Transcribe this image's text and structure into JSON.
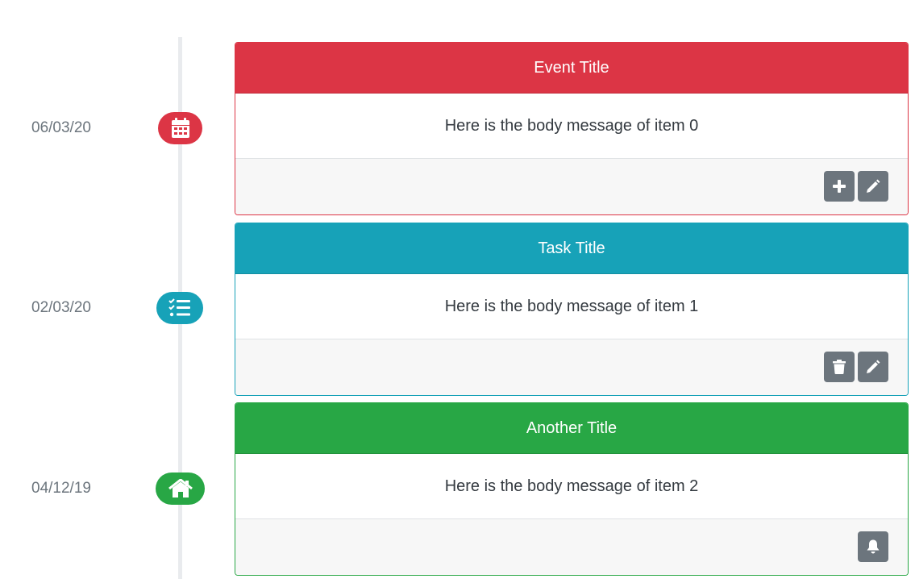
{
  "colors": {
    "danger": "#dc3545",
    "info": "#17a2b8",
    "success": "#28a745",
    "secondary": "#6c757d"
  },
  "timeline": {
    "items": [
      {
        "date": "06/03/20",
        "badge_icon": "calendar-icon",
        "title": "Event Title",
        "body": "Here is the body message of item 0",
        "actions": [
          "plus-icon",
          "pencil-icon"
        ]
      },
      {
        "date": "02/03/20",
        "badge_icon": "task-list-icon",
        "title": "Task Title",
        "body": "Here is the body message of item 1",
        "actions": [
          "trash-icon",
          "pencil-icon"
        ]
      },
      {
        "date": "04/12/19",
        "badge_icon": "home-icon",
        "title": "Another Title",
        "body": "Here is the body message of item 2",
        "actions": [
          "bell-icon"
        ]
      }
    ]
  }
}
